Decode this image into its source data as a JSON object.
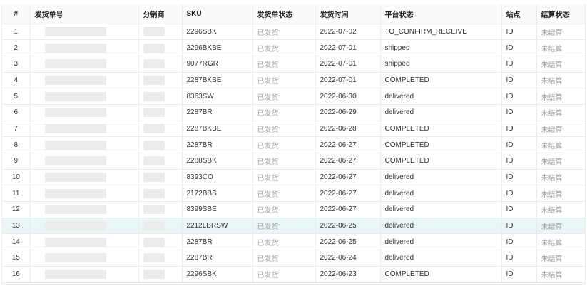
{
  "table": {
    "headers": {
      "index": "#",
      "order_no": "发货单号",
      "distributor": "分销商",
      "sku": "SKU",
      "ship_status": "发货单状态",
      "ship_time": "发货时间",
      "platform_status": "平台状态",
      "site": "站点",
      "settle_status": "结算状态"
    },
    "rows": [
      {
        "index": "1",
        "sku": "2296SBK",
        "ship_status": "已发货",
        "ship_time": "2022-07-02",
        "platform_status": "TO_CONFIRM_RECEIVE",
        "site": "ID",
        "settle_status": "未结算"
      },
      {
        "index": "2",
        "sku": "2296BKBE",
        "ship_status": "已发货",
        "ship_time": "2022-07-01",
        "platform_status": "shipped",
        "site": "ID",
        "settle_status": "未结算"
      },
      {
        "index": "3",
        "sku": "9077RGR",
        "ship_status": "已发货",
        "ship_time": "2022-07-01",
        "platform_status": "shipped",
        "site": "ID",
        "settle_status": "未结算"
      },
      {
        "index": "4",
        "sku": "2287BKBE",
        "ship_status": "已发货",
        "ship_time": "2022-07-01",
        "platform_status": "COMPLETED",
        "site": "ID",
        "settle_status": "未结算"
      },
      {
        "index": "5",
        "sku": "8363SW",
        "ship_status": "已发货",
        "ship_time": "2022-06-30",
        "platform_status": "delivered",
        "site": "ID",
        "settle_status": "未结算"
      },
      {
        "index": "6",
        "sku": "2287BR",
        "ship_status": "已发货",
        "ship_time": "2022-06-29",
        "platform_status": "delivered",
        "site": "ID",
        "settle_status": "未结算"
      },
      {
        "index": "7",
        "sku": "2287BKBE",
        "ship_status": "已发货",
        "ship_time": "2022-06-28",
        "platform_status": "COMPLETED",
        "site": "ID",
        "settle_status": "未结算"
      },
      {
        "index": "8",
        "sku": "2287BR",
        "ship_status": "已发货",
        "ship_time": "2022-06-27",
        "platform_status": "COMPLETED",
        "site": "ID",
        "settle_status": "未结算"
      },
      {
        "index": "9",
        "sku": "2288SBK",
        "ship_status": "已发货",
        "ship_time": "2022-06-27",
        "platform_status": "COMPLETED",
        "site": "ID",
        "settle_status": "未结算"
      },
      {
        "index": "10",
        "sku": "8393CO",
        "ship_status": "已发货",
        "ship_time": "2022-06-27",
        "platform_status": "delivered",
        "site": "ID",
        "settle_status": "未结算"
      },
      {
        "index": "11",
        "sku": "2172BBS",
        "ship_status": "已发货",
        "ship_time": "2022-06-27",
        "platform_status": "delivered",
        "site": "ID",
        "settle_status": "未结算"
      },
      {
        "index": "12",
        "sku": "8399SBE",
        "ship_status": "已发货",
        "ship_time": "2022-06-27",
        "platform_status": "delivered",
        "site": "ID",
        "settle_status": "未结算"
      },
      {
        "index": "13",
        "sku": "2212LBRSW",
        "ship_status": "已发货",
        "ship_time": "2022-06-25",
        "platform_status": "delivered",
        "site": "ID",
        "settle_status": "未结算",
        "highlighted": true
      },
      {
        "index": "14",
        "sku": "2287BR",
        "ship_status": "已发货",
        "ship_time": "2022-06-25",
        "platform_status": "delivered",
        "site": "ID",
        "settle_status": "未结算"
      },
      {
        "index": "15",
        "sku": "2287BR",
        "ship_status": "已发货",
        "ship_time": "2022-06-24",
        "platform_status": "delivered",
        "site": "ID",
        "settle_status": "未结算"
      },
      {
        "index": "16",
        "sku": "2296SBK",
        "ship_status": "已发货",
        "ship_time": "2022-06-23",
        "platform_status": "COMPLETED",
        "site": "ID",
        "settle_status": "未结算"
      }
    ]
  }
}
